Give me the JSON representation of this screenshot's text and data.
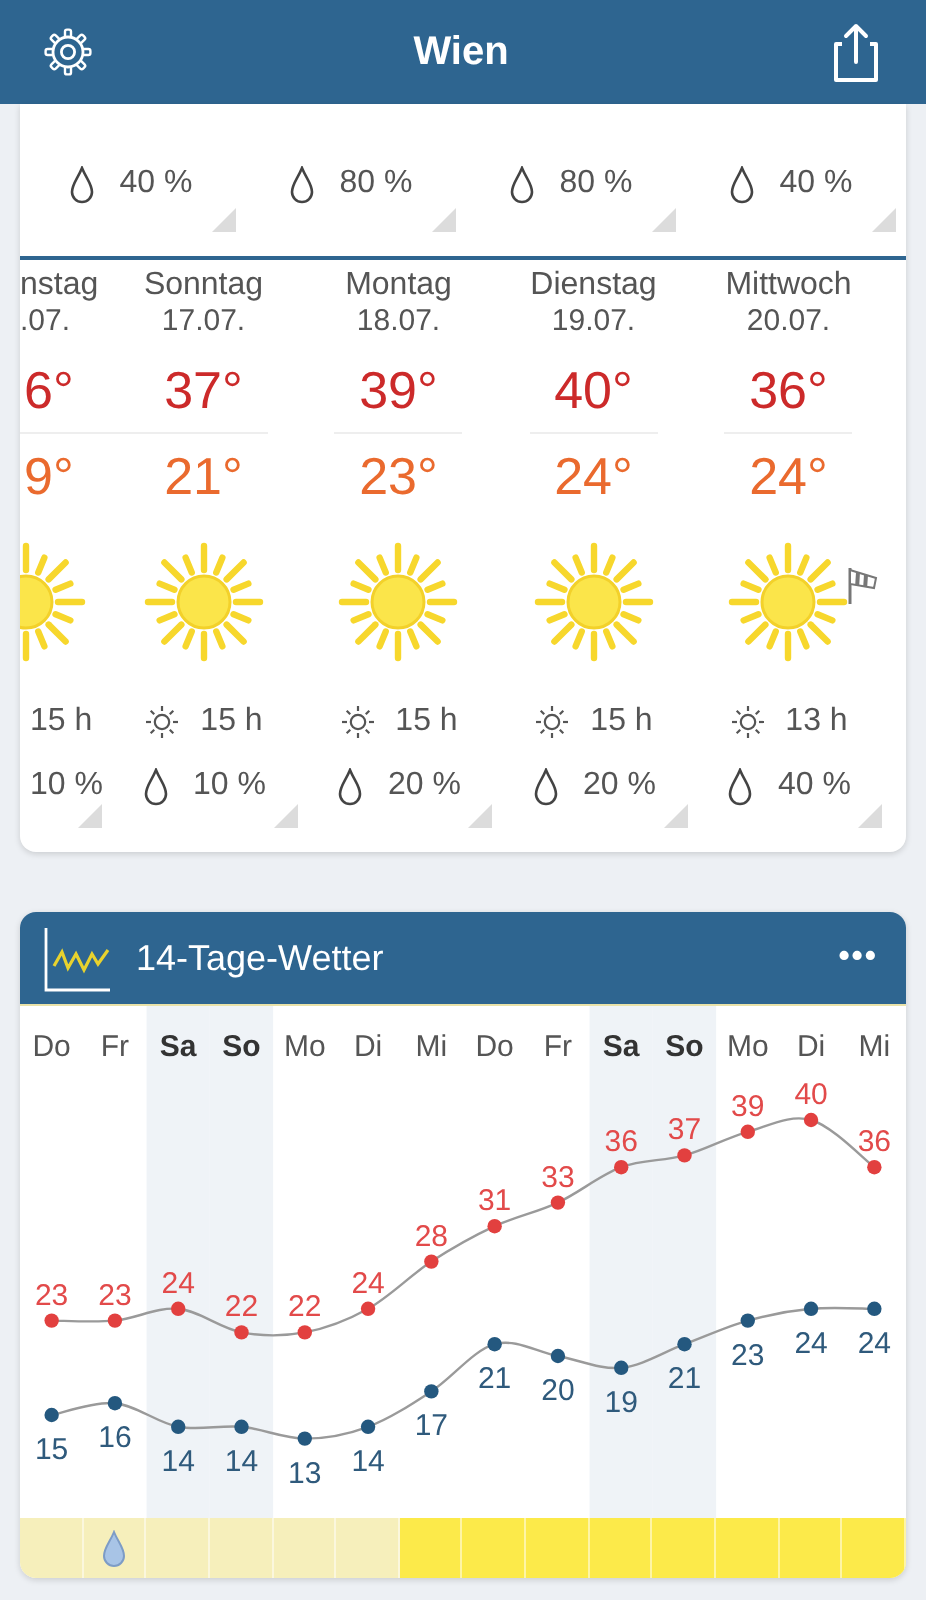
{
  "header": {
    "title": "Wien"
  },
  "previous_days": [
    {
      "rain": "40 %"
    },
    {
      "rain": "80 %"
    },
    {
      "rain": "80 %"
    },
    {
      "rain": "40 %"
    }
  ],
  "days": [
    {
      "kind": "cut",
      "name": "nstag",
      "date": ".07.",
      "high": "6°",
      "low": "9°",
      "sunshine": "15 h",
      "rain": "10 %",
      "wind": false
    },
    {
      "kind": "day",
      "name": "Sonntag",
      "date": "17.07.",
      "high": "37°",
      "low": "21°",
      "sunshine": "15 h",
      "rain": "10 %",
      "wind": false
    },
    {
      "kind": "day",
      "name": "Montag",
      "date": "18.07.",
      "high": "39°",
      "low": "23°",
      "sunshine": "15 h",
      "rain": "20 %",
      "wind": false
    },
    {
      "kind": "day",
      "name": "Dienstag",
      "date": "19.07.",
      "high": "40°",
      "low": "24°",
      "sunshine": "15 h",
      "rain": "20 %",
      "wind": false
    },
    {
      "kind": "day",
      "name": "Mittwoch",
      "date": "20.07.",
      "high": "36°",
      "low": "24°",
      "sunshine": "13 h",
      "rain": "40 %",
      "wind": true
    }
  ],
  "forecast_14": {
    "title": "14-Tage-Wetter",
    "menu": "•••",
    "days": [
      {
        "weekend": false,
        "color": "#f6efbb",
        "rain": false
      },
      {
        "weekend": false,
        "color": "#f6efbb",
        "rain": true
      },
      {
        "weekend": true,
        "color": "#f6efbb",
        "rain": false
      },
      {
        "weekend": true,
        "color": "#f6efbb",
        "rain": false
      },
      {
        "weekend": false,
        "color": "#f6efbb",
        "rain": false
      },
      {
        "weekend": false,
        "color": "#f6efbb",
        "rain": false
      },
      {
        "weekend": false,
        "color": "#fcea4a",
        "rain": false
      },
      {
        "weekend": false,
        "color": "#fcea4a",
        "rain": false
      },
      {
        "weekend": false,
        "color": "#fcea4a",
        "rain": false
      },
      {
        "weekend": true,
        "color": "#fcea4a",
        "rain": false
      },
      {
        "weekend": true,
        "color": "#fcea4a",
        "rain": false
      },
      {
        "weekend": false,
        "color": "#fcea4a",
        "rain": false
      },
      {
        "weekend": false,
        "color": "#fcea4a",
        "rain": false
      },
      {
        "weekend": false,
        "color": "#fcea4a",
        "rain": false
      }
    ],
    "chart_data": {
      "type": "line",
      "categories": [
        "Do",
        "Fr",
        "Sa",
        "So",
        "Mo",
        "Di",
        "Mi",
        "Do",
        "Fr",
        "Sa",
        "So",
        "Mo",
        "Di",
        "Mi"
      ],
      "data_labels": true,
      "series": [
        {
          "color": "#e2403f",
          "marker": "circle",
          "values": [
            23,
            23,
            24,
            22,
            22,
            24,
            28,
            31,
            33,
            36,
            37,
            39,
            40,
            36
          ]
        },
        {
          "color": "#24587f",
          "marker": "circle",
          "values": [
            15,
            16,
            14,
            14,
            13,
            14,
            17,
            21,
            20,
            19,
            21,
            23,
            24,
            24
          ]
        }
      ]
    }
  }
}
